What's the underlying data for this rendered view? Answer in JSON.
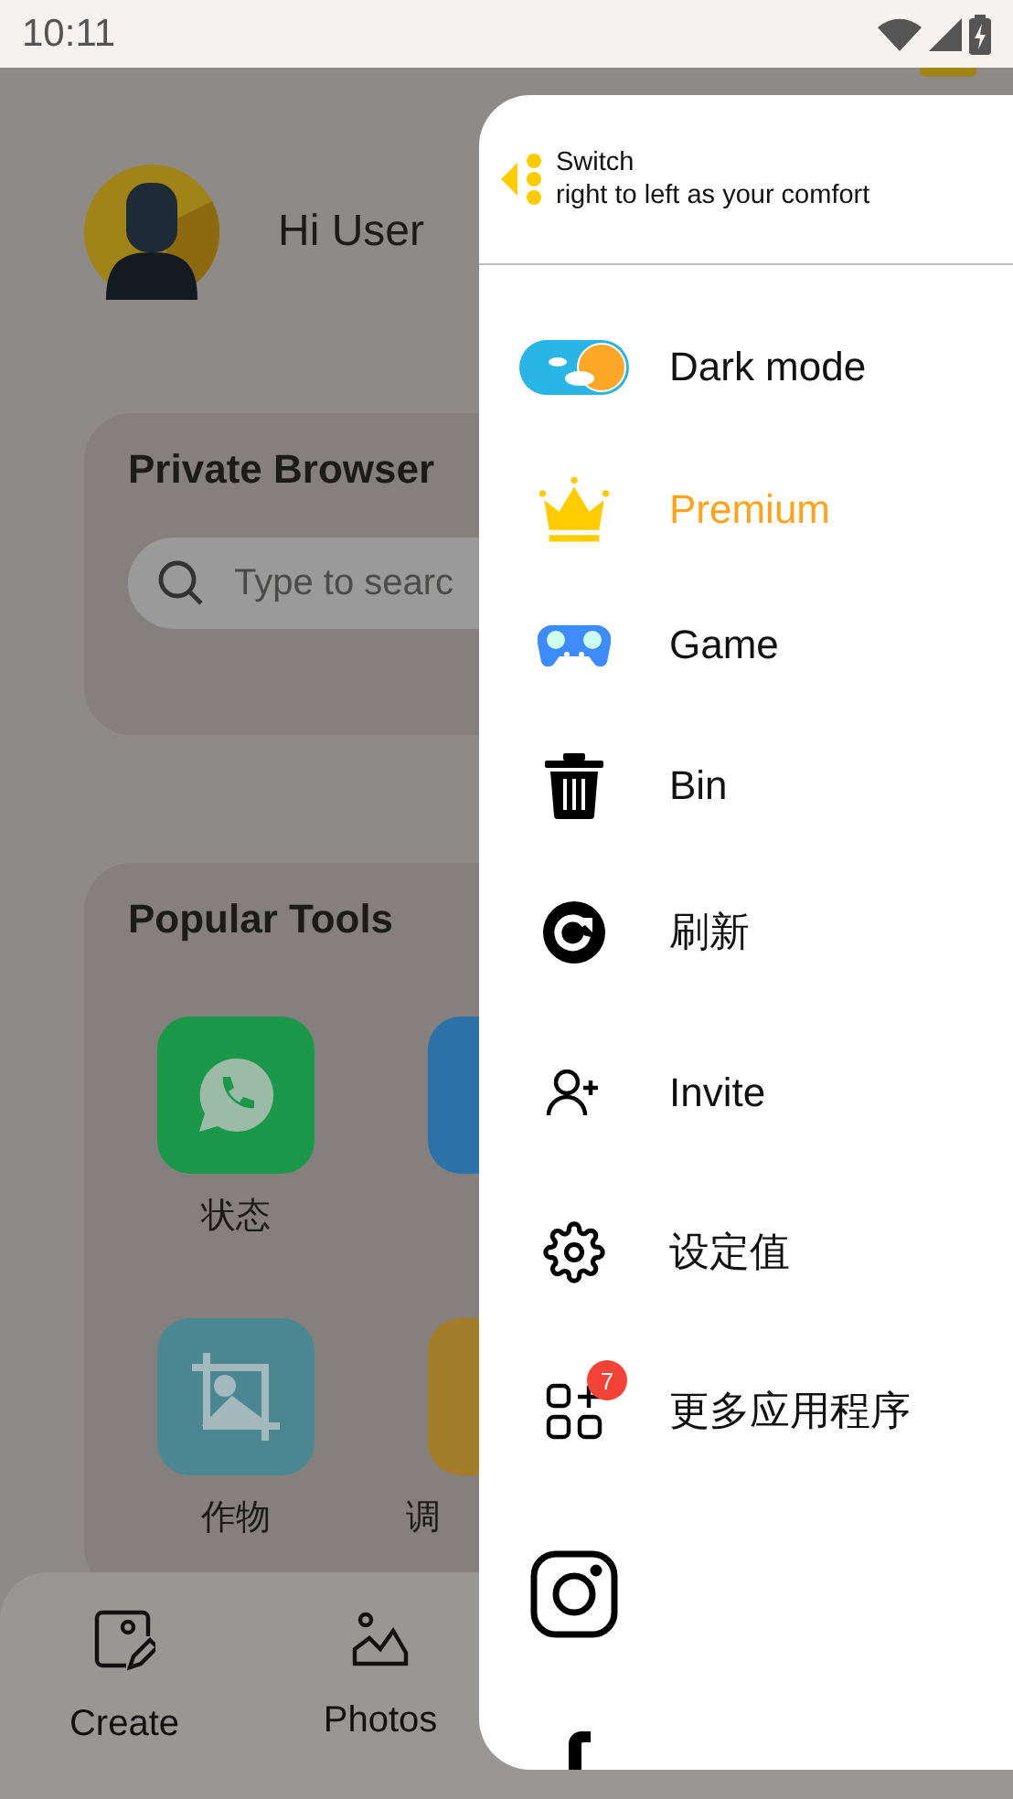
{
  "status_bar": {
    "time": "10:11"
  },
  "greeting": "Hi User",
  "browser_card": {
    "title": "Private Browser",
    "search": {
      "placeholder": "Type to searc"
    }
  },
  "tools_card": {
    "title": "Popular Tools",
    "tools": [
      {
        "label": "状态",
        "color": "#1a9748"
      },
      {
        "color": "#2a72a8"
      },
      {
        "label": "作物",
        "color": "#4b8790"
      },
      {
        "label": "调",
        "color": "#a37e2a"
      }
    ]
  },
  "bottom_nav": [
    {
      "label": "Create"
    },
    {
      "label": "Photos"
    }
  ],
  "drawer": {
    "hint": [
      "Switch",
      "right to left as your comfort"
    ],
    "items": [
      {
        "kind": "toggle",
        "label": "Dark mode",
        "on": false
      },
      {
        "kind": "premium",
        "label": "Premium"
      },
      {
        "kind": "plain",
        "label": "Game"
      },
      {
        "kind": "plain",
        "label": "Bin"
      },
      {
        "kind": "plain",
        "label": "刷新"
      },
      {
        "kind": "plain",
        "label": "Invite"
      },
      {
        "kind": "plain",
        "label": "设定值"
      },
      {
        "kind": "badge",
        "label": "更多应用程序",
        "badge": "7"
      }
    ]
  }
}
